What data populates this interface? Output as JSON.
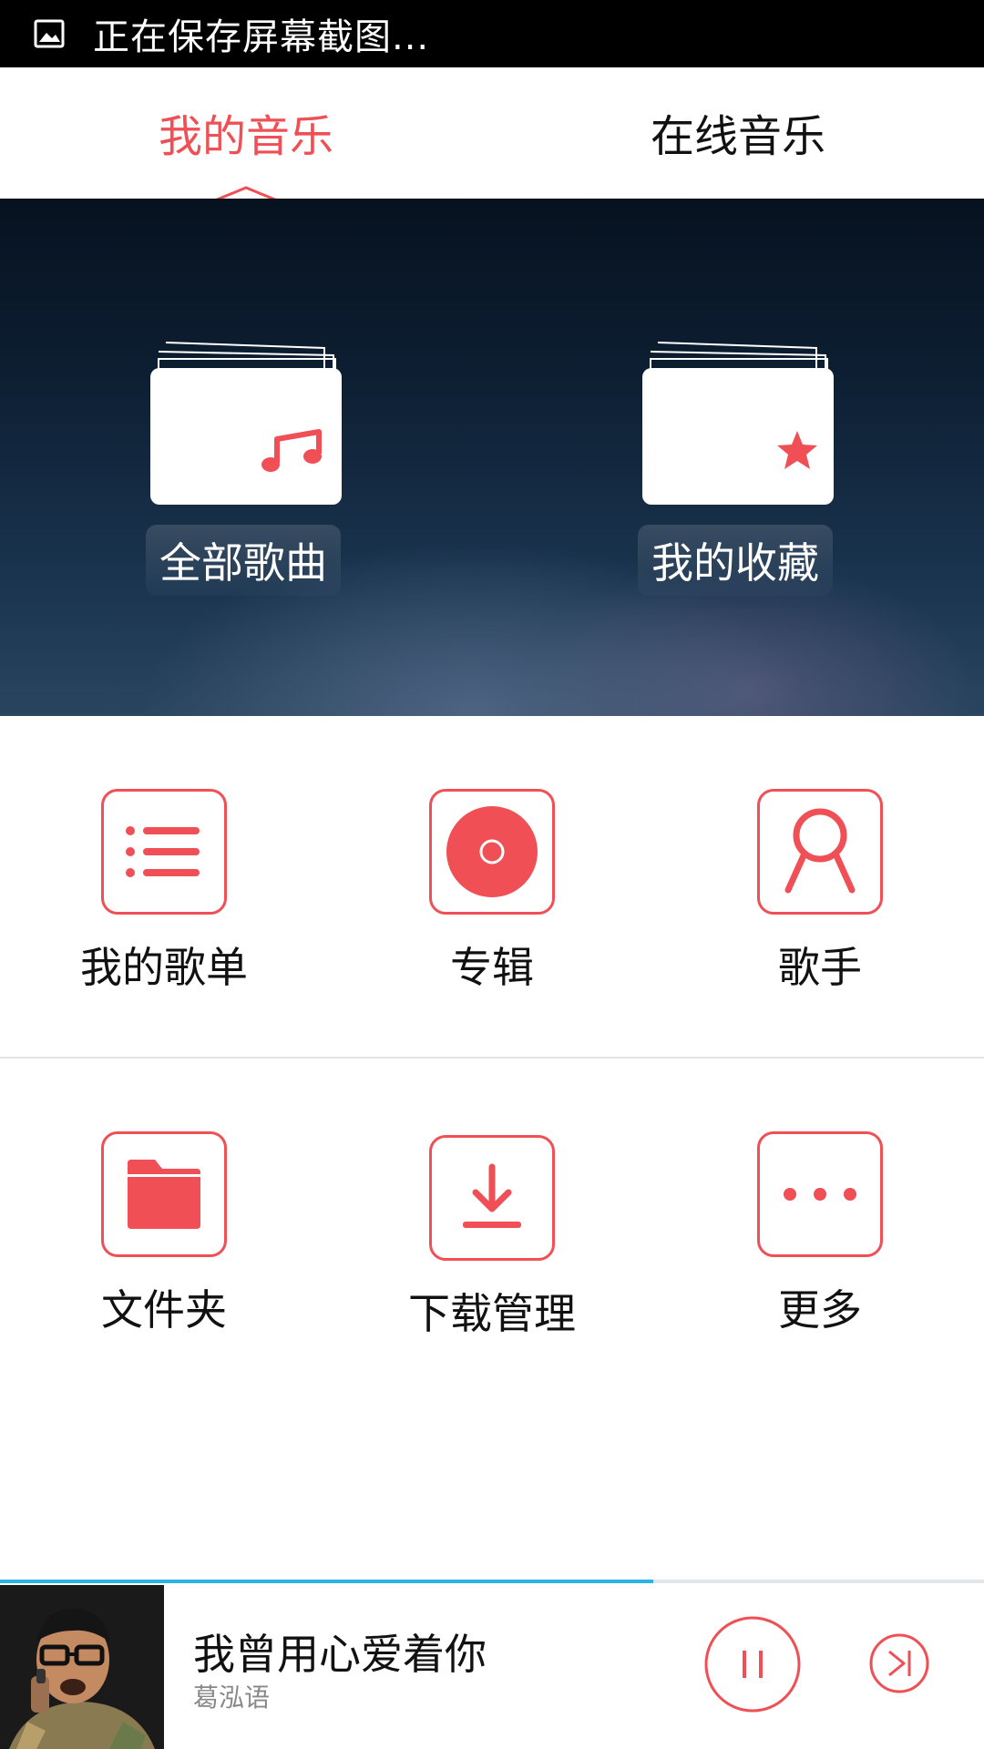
{
  "status_bar": {
    "text": "正在保存屏幕截图..."
  },
  "tabs": [
    {
      "label": "我的音乐",
      "active": true
    },
    {
      "label": "在线音乐",
      "active": false
    }
  ],
  "hero": {
    "cards": [
      {
        "label": "全部歌曲",
        "icon": "music-note-icon"
      },
      {
        "label": "我的收藏",
        "icon": "star-icon"
      }
    ]
  },
  "grid": [
    {
      "label": "我的歌单",
      "icon": "list-icon"
    },
    {
      "label": "专辑",
      "icon": "album-disc-icon"
    },
    {
      "label": "歌手",
      "icon": "singer-icon"
    },
    {
      "label": "文件夹",
      "icon": "folder-icon"
    },
    {
      "label": "下载管理",
      "icon": "download-icon"
    },
    {
      "label": "更多",
      "icon": "more-dots-icon"
    }
  ],
  "player": {
    "title": "我曾用心爱着你",
    "artist": "葛泓语",
    "progress": 0.664
  },
  "colors": {
    "accent": "#ef4f55",
    "progress": "#2bb3e3",
    "status_bar": "#000000"
  }
}
